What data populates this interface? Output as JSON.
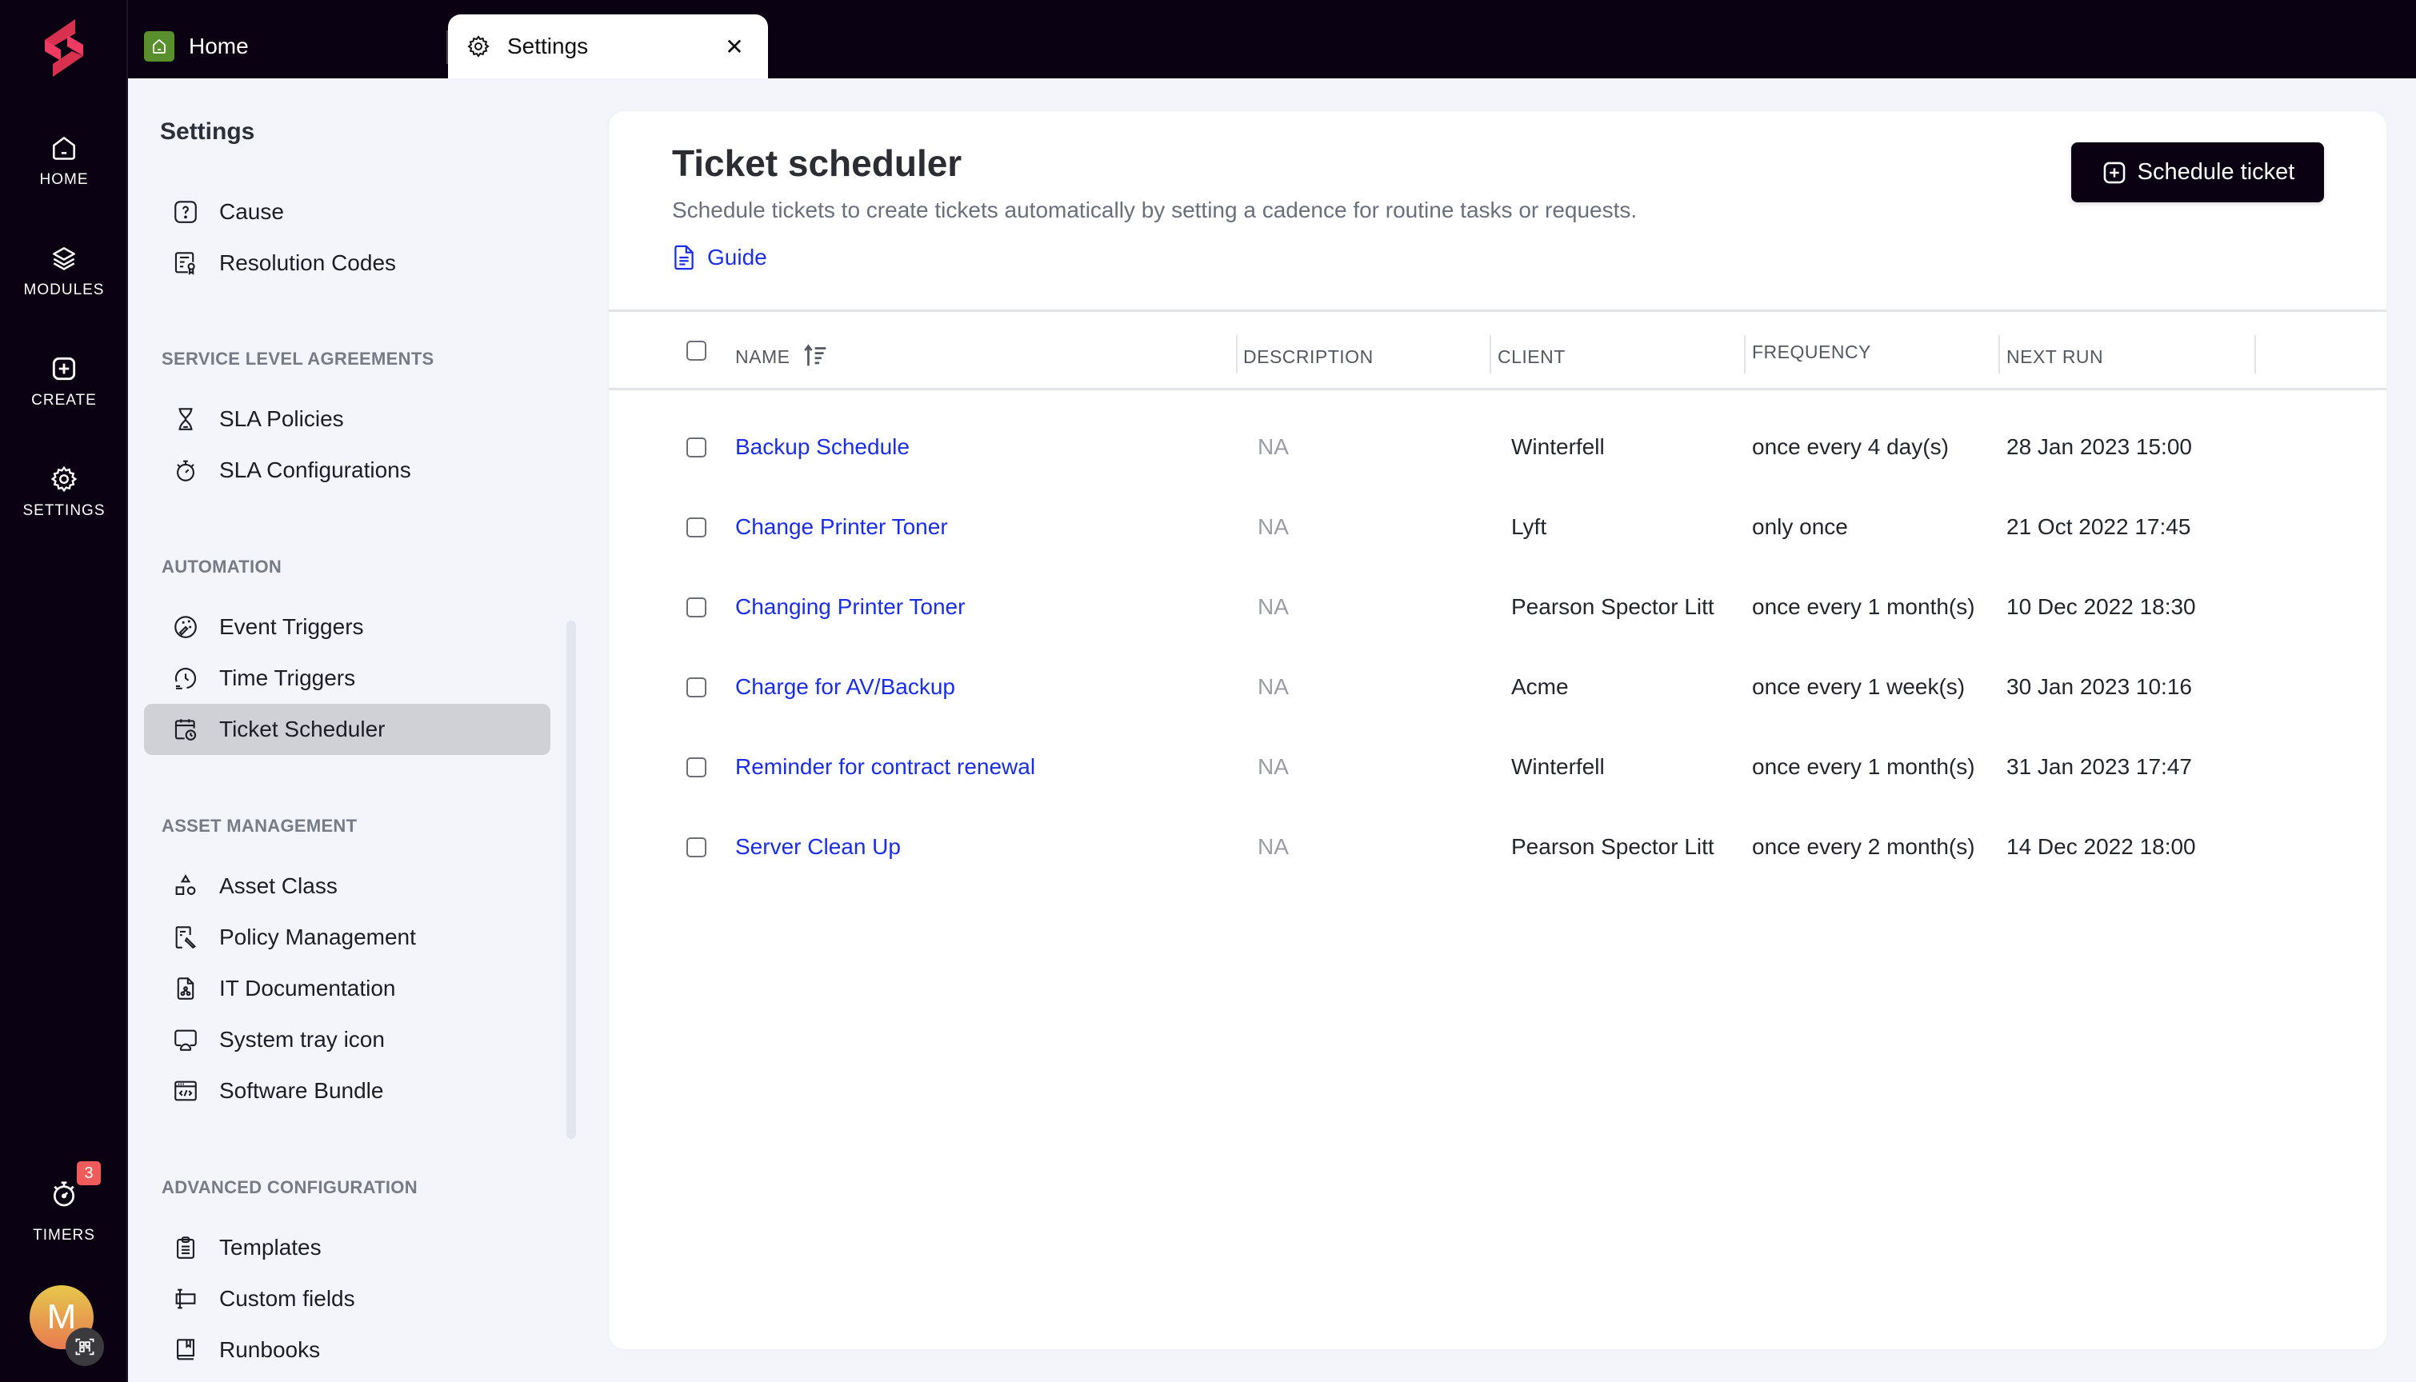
{
  "app": {
    "brand_color": "#e8355a",
    "rail": [
      {
        "id": "home",
        "label": "HOME",
        "icon": "home-icon"
      },
      {
        "id": "modules",
        "label": "MODULES",
        "icon": "layers-icon"
      },
      {
        "id": "create",
        "label": "CREATE",
        "icon": "plus-square-icon"
      },
      {
        "id": "settings",
        "label": "SETTINGS",
        "icon": "gear-icon"
      },
      {
        "id": "timers",
        "label": "TIMERS",
        "icon": "stopwatch-icon",
        "badge": "3"
      }
    ],
    "avatar_initial": "M"
  },
  "tabs": [
    {
      "label": "Home",
      "icon": "home-icon",
      "active": false
    },
    {
      "label": "Settings",
      "icon": "gear-icon",
      "active": true,
      "close": "✕"
    }
  ],
  "nav": {
    "title": "Settings",
    "items_top": [
      {
        "label": "Cause",
        "icon": "question-square-icon"
      },
      {
        "label": "Resolution Codes",
        "icon": "certificate-icon"
      }
    ],
    "sections": [
      {
        "title": "SERVICE LEVEL AGREEMENTS",
        "items": [
          {
            "label": "SLA Policies",
            "icon": "hourglass-icon"
          },
          {
            "label": "SLA Configurations",
            "icon": "stopwatch-icon"
          }
        ]
      },
      {
        "title": "AUTOMATION",
        "items": [
          {
            "label": "Event Triggers",
            "icon": "magic-wand-icon"
          },
          {
            "label": "Time Triggers",
            "icon": "clock-icon"
          },
          {
            "label": "Ticket Scheduler",
            "icon": "calendar-clock-icon",
            "active": true
          }
        ]
      },
      {
        "title": "ASSET MANAGEMENT",
        "items": [
          {
            "label": "Asset Class",
            "icon": "shapes-icon"
          },
          {
            "label": "Policy Management",
            "icon": "file-brush-icon"
          },
          {
            "label": "IT Documentation",
            "icon": "file-network-icon"
          },
          {
            "label": "System tray icon",
            "icon": "monitor-cloud-icon"
          },
          {
            "label": "Software Bundle",
            "icon": "code-window-icon"
          }
        ]
      },
      {
        "title": "ADVANCED CONFIGURATION",
        "items": [
          {
            "label": "Templates",
            "icon": "clipboard-icon"
          },
          {
            "label": "Custom fields",
            "icon": "text-field-icon"
          },
          {
            "label": "Runbooks",
            "icon": "book-icon"
          }
        ]
      }
    ]
  },
  "page": {
    "title": "Ticket scheduler",
    "subtitle": "Schedule tickets to create tickets automatically by setting a cadence for routine tasks or requests.",
    "guide_label": "Guide",
    "schedule_button": "Schedule ticket",
    "link_color": "#1a2ee8"
  },
  "table": {
    "columns": [
      "NAME",
      "DESCRIPTION",
      "CLIENT",
      "FREQUENCY",
      "NEXT RUN"
    ],
    "sort": {
      "column": "NAME",
      "direction": "ascending"
    },
    "rows": [
      {
        "name": "Backup Schedule",
        "description": "NA",
        "client": "Winterfell",
        "frequency": "once every 4 day(s)",
        "next_run": "28 Jan 2023 15:00"
      },
      {
        "name": "Change Printer Toner",
        "description": "NA",
        "client": "Lyft",
        "frequency": "only once",
        "next_run": "21 Oct 2022 17:45"
      },
      {
        "name": "Changing Printer Toner",
        "description": "NA",
        "client": "Pearson Spector Litt",
        "frequency": "once every 1 month(s)",
        "next_run": "10 Dec 2022 18:30"
      },
      {
        "name": "Charge for AV/Backup",
        "description": "NA",
        "client": "Acme",
        "frequency": "once every 1 week(s)",
        "next_run": "30 Jan 2023 10:16"
      },
      {
        "name": "Reminder for contract renewal",
        "description": "NA",
        "client": "Winterfell",
        "frequency": "once every 1 month(s)",
        "next_run": "31 Jan 2023 17:47"
      },
      {
        "name": "Server Clean Up",
        "description": "NA",
        "client": "Pearson Spector Litt",
        "frequency": "once every 2 month(s)",
        "next_run": "14 Dec 2022 18:00"
      }
    ]
  }
}
